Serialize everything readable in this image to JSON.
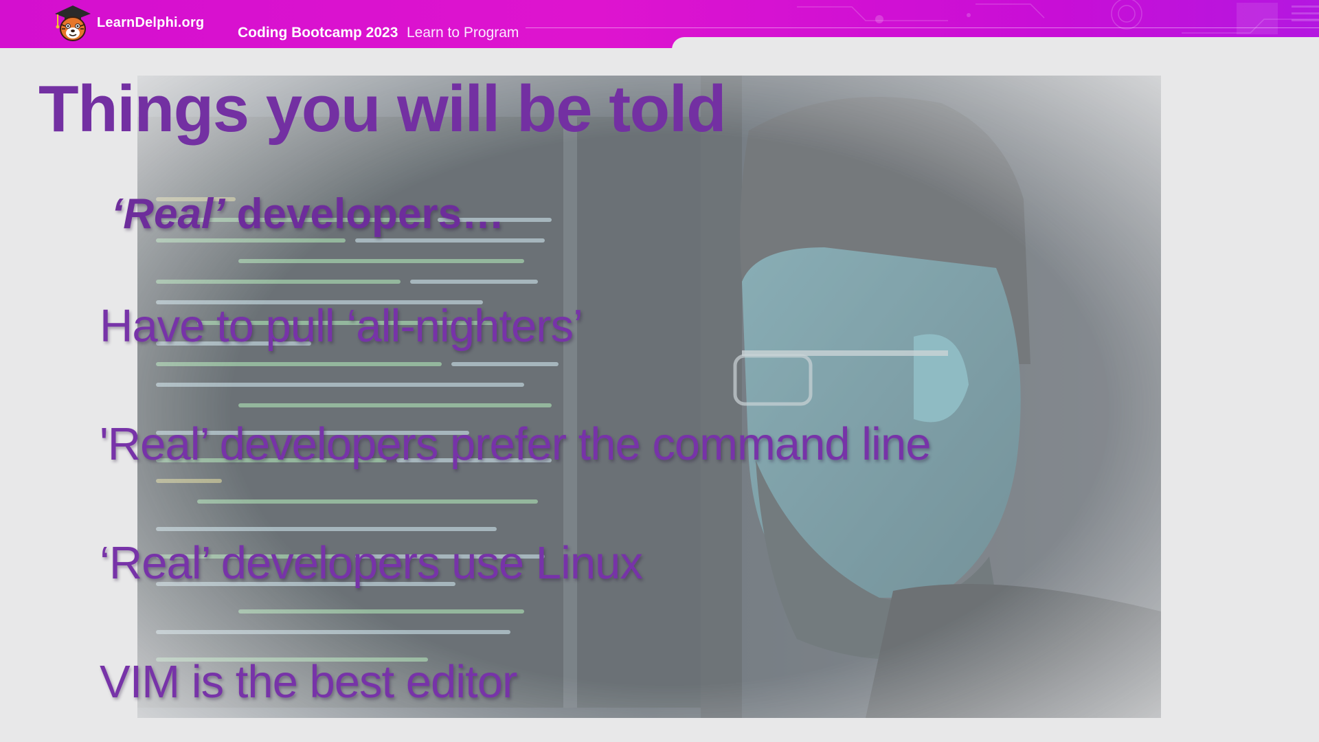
{
  "header": {
    "site_name": "LearnDelphi.org",
    "bootcamp_title": "Coding Bootcamp 2023",
    "bootcamp_subtitle": "Learn to Program",
    "brand_color": "#d812cf"
  },
  "slide": {
    "title": "Things you will be told",
    "subtitle_emphasis": "‘Real’",
    "subtitle_rest": " developers…",
    "bullets": [
      "Have to pull ‘all-nighters’",
      "'Real’ developers prefer the command line",
      "‘Real’ developers use Linux",
      "VIM is the best editor"
    ],
    "text_color": "#7330a2",
    "background_image": "developer-at-monitor-photo"
  }
}
